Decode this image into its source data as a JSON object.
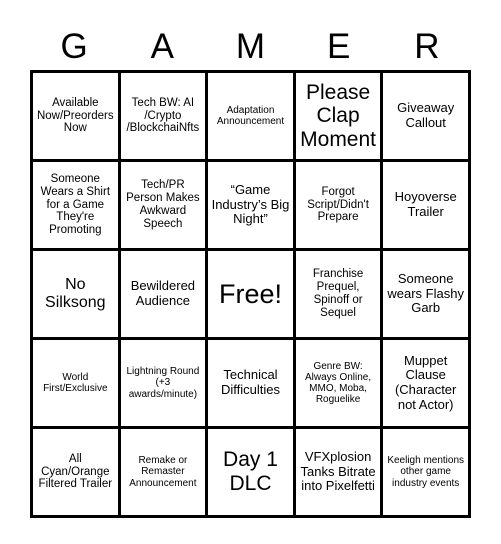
{
  "card": {
    "title_letters": [
      "G",
      "A",
      "M",
      "E",
      "R"
    ],
    "rows": [
      [
        {
          "text": "Available Now/Preorders Now",
          "size": "s"
        },
        {
          "text": "Tech BW: AI /Crypto /BlockchaiNfts",
          "size": "s"
        },
        {
          "text": "Adaptation Announcement",
          "size": "xs"
        },
        {
          "text": "Please Clap Moment",
          "size": "xl"
        },
        {
          "text": "Giveaway Callout",
          "size": "m"
        }
      ],
      [
        {
          "text": "Someone Wears a Shirt for a Game They're Promoting",
          "size": "s"
        },
        {
          "text": "Tech/PR Person Makes Awkward Speech",
          "size": "s"
        },
        {
          "text": "“Game Industry’s Big Night”",
          "size": "m"
        },
        {
          "text": "Forgot Script/Didn't Prepare",
          "size": "s"
        },
        {
          "text": "Hoyoverse Trailer",
          "size": "m"
        }
      ],
      [
        {
          "text": "No Silksong",
          "size": "l"
        },
        {
          "text": "Bewildered Audience",
          "size": "m"
        },
        {
          "text": "Free!",
          "size": "xxl"
        },
        {
          "text": "Franchise Prequel, Spinoff or Sequel",
          "size": "s"
        },
        {
          "text": "Someone wears Flashy Garb",
          "size": "m"
        }
      ],
      [
        {
          "text": "World First/Exclusive",
          "size": "xs"
        },
        {
          "text": "Lightning Round (+3 awards/minute)",
          "size": "xs"
        },
        {
          "text": "Technical Difficulties",
          "size": "m"
        },
        {
          "text": "Genre BW: Always Online, MMO, Moba, Roguelike",
          "size": "xs"
        },
        {
          "text": "Muppet Clause (Character not Actor)",
          "size": "m"
        }
      ],
      [
        {
          "text": "All Cyan/Orange Filtered Trailer",
          "size": "s"
        },
        {
          "text": "Remake or Remaster Announcement",
          "size": "xs"
        },
        {
          "text": "Day 1 DLC",
          "size": "xl"
        },
        {
          "text": "VFXplosion Tanks Bitrate into Pixelfetti",
          "size": "m"
        },
        {
          "text": "Keeligh mentions other game industry events",
          "size": "xs"
        }
      ]
    ]
  },
  "colors": {
    "background": "#ffffff",
    "border": "#000000",
    "text": "#000000"
  }
}
